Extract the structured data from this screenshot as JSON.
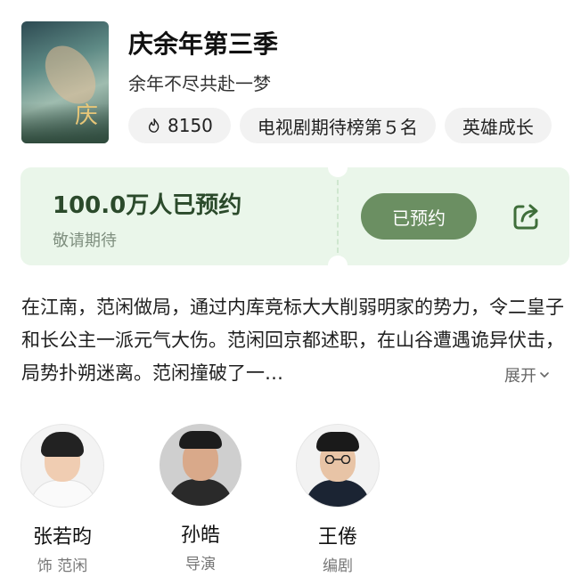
{
  "show": {
    "title": "庆余年第三季",
    "subtitle": "余年不尽共赴一梦"
  },
  "tags": [
    {
      "icon": "fire-icon",
      "label": "8150"
    },
    {
      "label": "电视剧期待榜第５名"
    },
    {
      "label": "英雄成长"
    }
  ],
  "reservation": {
    "count_text": "100.0万人已预约",
    "hint": "敬请期待",
    "button_label": "已预约",
    "share_icon": "share-icon"
  },
  "description": {
    "text": "在江南，范闲做局，通过内库竞标大大削弱明家的势力，令二皇子和长公主一派元气大伤。范闲回京都述职，在山谷遭遇诡异伏击，局势扑朔迷离。范闲撞破了一…",
    "expand_label": "展开"
  },
  "cast": [
    {
      "name": "张若昀",
      "role": "饰 范闲"
    },
    {
      "name": "孙皓",
      "role": "导演"
    },
    {
      "name": "王倦",
      "role": "编剧"
    }
  ],
  "colors": {
    "card_bg": "#eaf6ea",
    "button_bg": "#6b8f62",
    "accent_text": "#2b4a2b"
  }
}
